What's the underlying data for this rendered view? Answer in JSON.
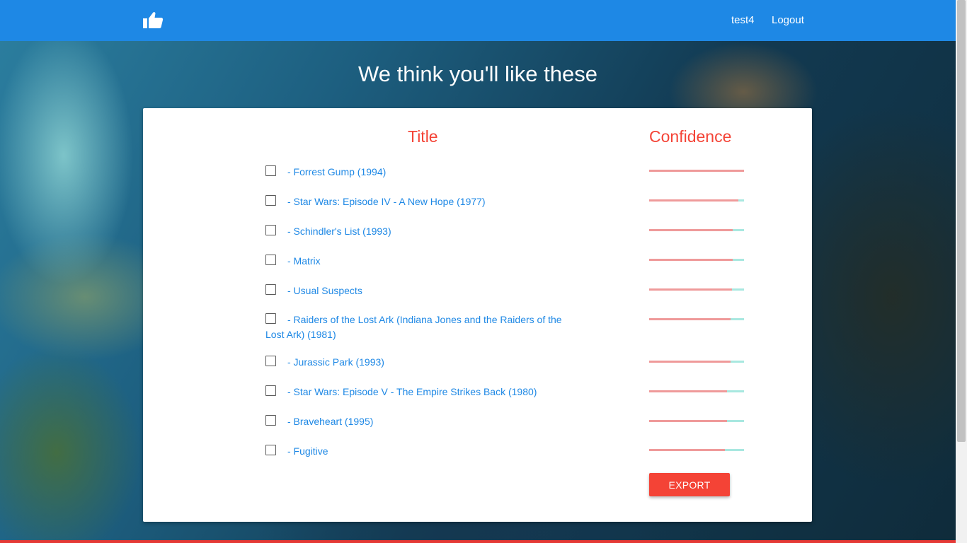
{
  "header": {
    "logo_icon": "thumbs-up-icon",
    "user_label": "test4",
    "logout_label": "Logout"
  },
  "page": {
    "title": "We think you'll like these"
  },
  "table": {
    "title_header": "Title",
    "confidence_header": "Confidence",
    "items": [
      {
        "title": "- Forrest Gump (1994)",
        "checked": false,
        "confidence": 1.0
      },
      {
        "title": "- Star Wars: Episode IV - A New Hope (1977)",
        "checked": false,
        "confidence": 0.94
      },
      {
        "title": "- Schindler's List (1993)",
        "checked": false,
        "confidence": 0.88
      },
      {
        "title": "- Matrix",
        "checked": false,
        "confidence": 0.88
      },
      {
        "title": "- Usual Suspects",
        "checked": false,
        "confidence": 0.87
      },
      {
        "title": "- Raiders of the Lost Ark (Indiana Jones and the Raiders of the Lost Ark) (1981)",
        "checked": false,
        "confidence": 0.86
      },
      {
        "title": "- Jurassic Park (1993)",
        "checked": false,
        "confidence": 0.86
      },
      {
        "title": "- Star Wars: Episode V - The Empire Strikes Back (1980)",
        "checked": false,
        "confidence": 0.82
      },
      {
        "title": "- Braveheart (1995)",
        "checked": false,
        "confidence": 0.82
      },
      {
        "title": "- Fugitive",
        "checked": false,
        "confidence": 0.8
      }
    ]
  },
  "actions": {
    "export_label": "EXPORT"
  },
  "colors": {
    "accent": "#1e88e5",
    "header_red": "#f44336",
    "bar_fill": "#ef9a9a",
    "bar_track": "#a8e8e0"
  }
}
